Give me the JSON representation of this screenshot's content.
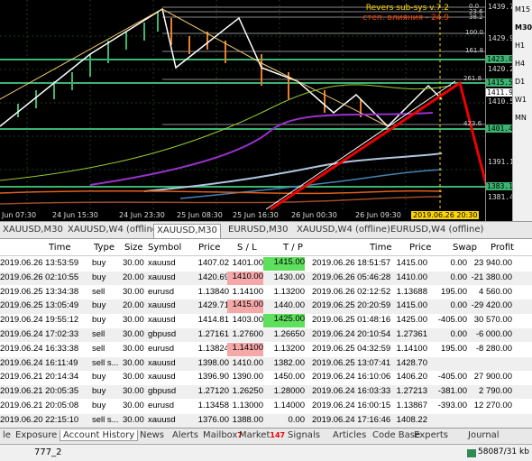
{
  "chart": {
    "indicator_line1": "Revers sub-sys v.7.2",
    "indicator_line2": "степ. влияния - 24.9",
    "y_labels": [
      "1439.70",
      "1429.90",
      "1420.20",
      "1410.50",
      "1391.10",
      "1381.40"
    ],
    "price_boxes": [
      {
        "text": "1423.07",
        "bg": "#3cb371",
        "color": "#000"
      },
      {
        "text": "1415.59",
        "bg": "#3cb371",
        "color": "#000"
      },
      {
        "text": "1411.97",
        "bg": "#ffffff",
        "color": "#000"
      },
      {
        "text": "1401.44",
        "bg": "#3cb371",
        "color": "#000"
      },
      {
        "text": "1383.14",
        "bg": "#3cb371",
        "color": "#000"
      }
    ],
    "fib_levels": [
      "0.0",
      "23.6",
      "38.2",
      "100.0",
      "161.8",
      "261.8",
      "423.6"
    ],
    "x_labels": [
      "Jun 07:30",
      "24 Jun 15:30",
      "24 Jun 23:30",
      "25 Jun 08:30",
      "25 Jun 16:30",
      "26 Jun 00:30",
      "26 Jun 09:30"
    ],
    "x_current": "2019.06.26 20:30",
    "timeframes": [
      "M15",
      "M30",
      "H1",
      "H4",
      "D1",
      "W1",
      "MN"
    ]
  },
  "chart_tabs": [
    "XAUUSD,M30",
    "XAUUSD,W4 (offline)",
    "XAUUSD,M30",
    "EURUSD,M30",
    "XAUUSD,W4 (offline)",
    "EURUSD,W4 (offline)"
  ],
  "active_chart_tab": 2,
  "table": {
    "headers": [
      "Time",
      "Type",
      "Size",
      "Symbol",
      "Price",
      "S / L",
      "T / P",
      "Time",
      "Price",
      "Swap",
      "Profit"
    ],
    "rows": [
      [
        "2019.06.26 13:53:59",
        "buy",
        "30.00",
        "xauusd",
        "1407.02",
        "1401.00",
        "1415.00",
        "2019.06.26 18:51:57",
        "1415.00",
        "0.00",
        "23 940.00"
      ],
      [
        "2019.06.26 02:10:55",
        "buy",
        "20.00",
        "xauusd",
        "1420.69",
        "1410.00",
        "1430.00",
        "2019.06.26 05:46:28",
        "1410.00",
        "0.00",
        "-21 380.00"
      ],
      [
        "2019.06.25 13:34:38",
        "sell",
        "30.00",
        "eurusd",
        "1.13840",
        "1.14100",
        "1.13200",
        "2019.06.26 02:12:52",
        "1.13688",
        "195.00",
        "4 560.00"
      ],
      [
        "2019.06.25 13:05:49",
        "buy",
        "20.00",
        "xauusd",
        "1429.71",
        "1415.00",
        "1440.00",
        "2019.06.25 20:20:59",
        "1415.00",
        "0.00",
        "-29 420.00"
      ],
      [
        "2019.06.24 19:55:12",
        "buy",
        "30.00",
        "xauusd",
        "1414.81",
        "1403.00",
        "1425.00",
        "2019.06.25 01:48:16",
        "1425.00",
        "-405.00",
        "30 570.00"
      ],
      [
        "2019.06.24 17:02:33",
        "sell",
        "30.00",
        "gbpusd",
        "1.27161",
        "1.27600",
        "1.26650",
        "2019.06.24 20:10:54",
        "1.27361",
        "0.00",
        "-6 000.00"
      ],
      [
        "2019.06.24 16:33:38",
        "sell",
        "30.00",
        "eurusd",
        "1.13824",
        "1.14100",
        "1.13200",
        "2019.06.25 04:32:59",
        "1.14100",
        "195.00",
        "-8 280.00"
      ],
      [
        "2019.06.24 16:11:49",
        "sell s...",
        "30.00",
        "xauusd",
        "1398.00",
        "1410.00",
        "1382.00",
        "2019.06.25 13:07:41",
        "1428.70",
        "",
        ""
      ],
      [
        "2019.06.21 20:14:34",
        "buy",
        "30.00",
        "xauusd",
        "1396.90",
        "1390.00",
        "1450.00",
        "2019.06.24 16:10:06",
        "1406.20",
        "-405.00",
        "27 900.00"
      ],
      [
        "2019.06.21 20:05:35",
        "buy",
        "30.00",
        "gbpusd",
        "1.27120",
        "1.26250",
        "1.28000",
        "2019.06.24 16:03:33",
        "1.27213",
        "-381.00",
        "2 790.00"
      ],
      [
        "2019.06.21 20:05:08",
        "buy",
        "30.00",
        "eurusd",
        "1.13458",
        "1.13000",
        "1.14000",
        "2019.06.24 16:00:15",
        "1.13867",
        "-393.00",
        "12 270.00"
      ],
      [
        "2019.06.20 22:15:10",
        "sell s...",
        "30.00",
        "xauusd",
        "1376.00",
        "1388.00",
        "0.00",
        "2019.06.24 17:16:46",
        "1408.22",
        "",
        ""
      ]
    ]
  },
  "bottom_tabs": [
    {
      "label": "le",
      "badge": ""
    },
    {
      "label": "Exposure",
      "badge": ""
    },
    {
      "label": "Account History",
      "badge": ""
    },
    {
      "label": "News",
      "badge": ""
    },
    {
      "label": "Alerts",
      "badge": ""
    },
    {
      "label": "Mailbox",
      "badge": "7"
    },
    {
      "label": "Market",
      "badge": "147"
    },
    {
      "label": "Signals",
      "badge": ""
    },
    {
      "label": "Articles",
      "badge": ""
    },
    {
      "label": "Code Base",
      "badge": ""
    },
    {
      "label": "Experts",
      "badge": ""
    },
    {
      "label": "Journal",
      "badge": ""
    }
  ],
  "active_bottom_tab": 2,
  "status": {
    "profile": "777_2",
    "traffic": "58087/31 kb"
  }
}
